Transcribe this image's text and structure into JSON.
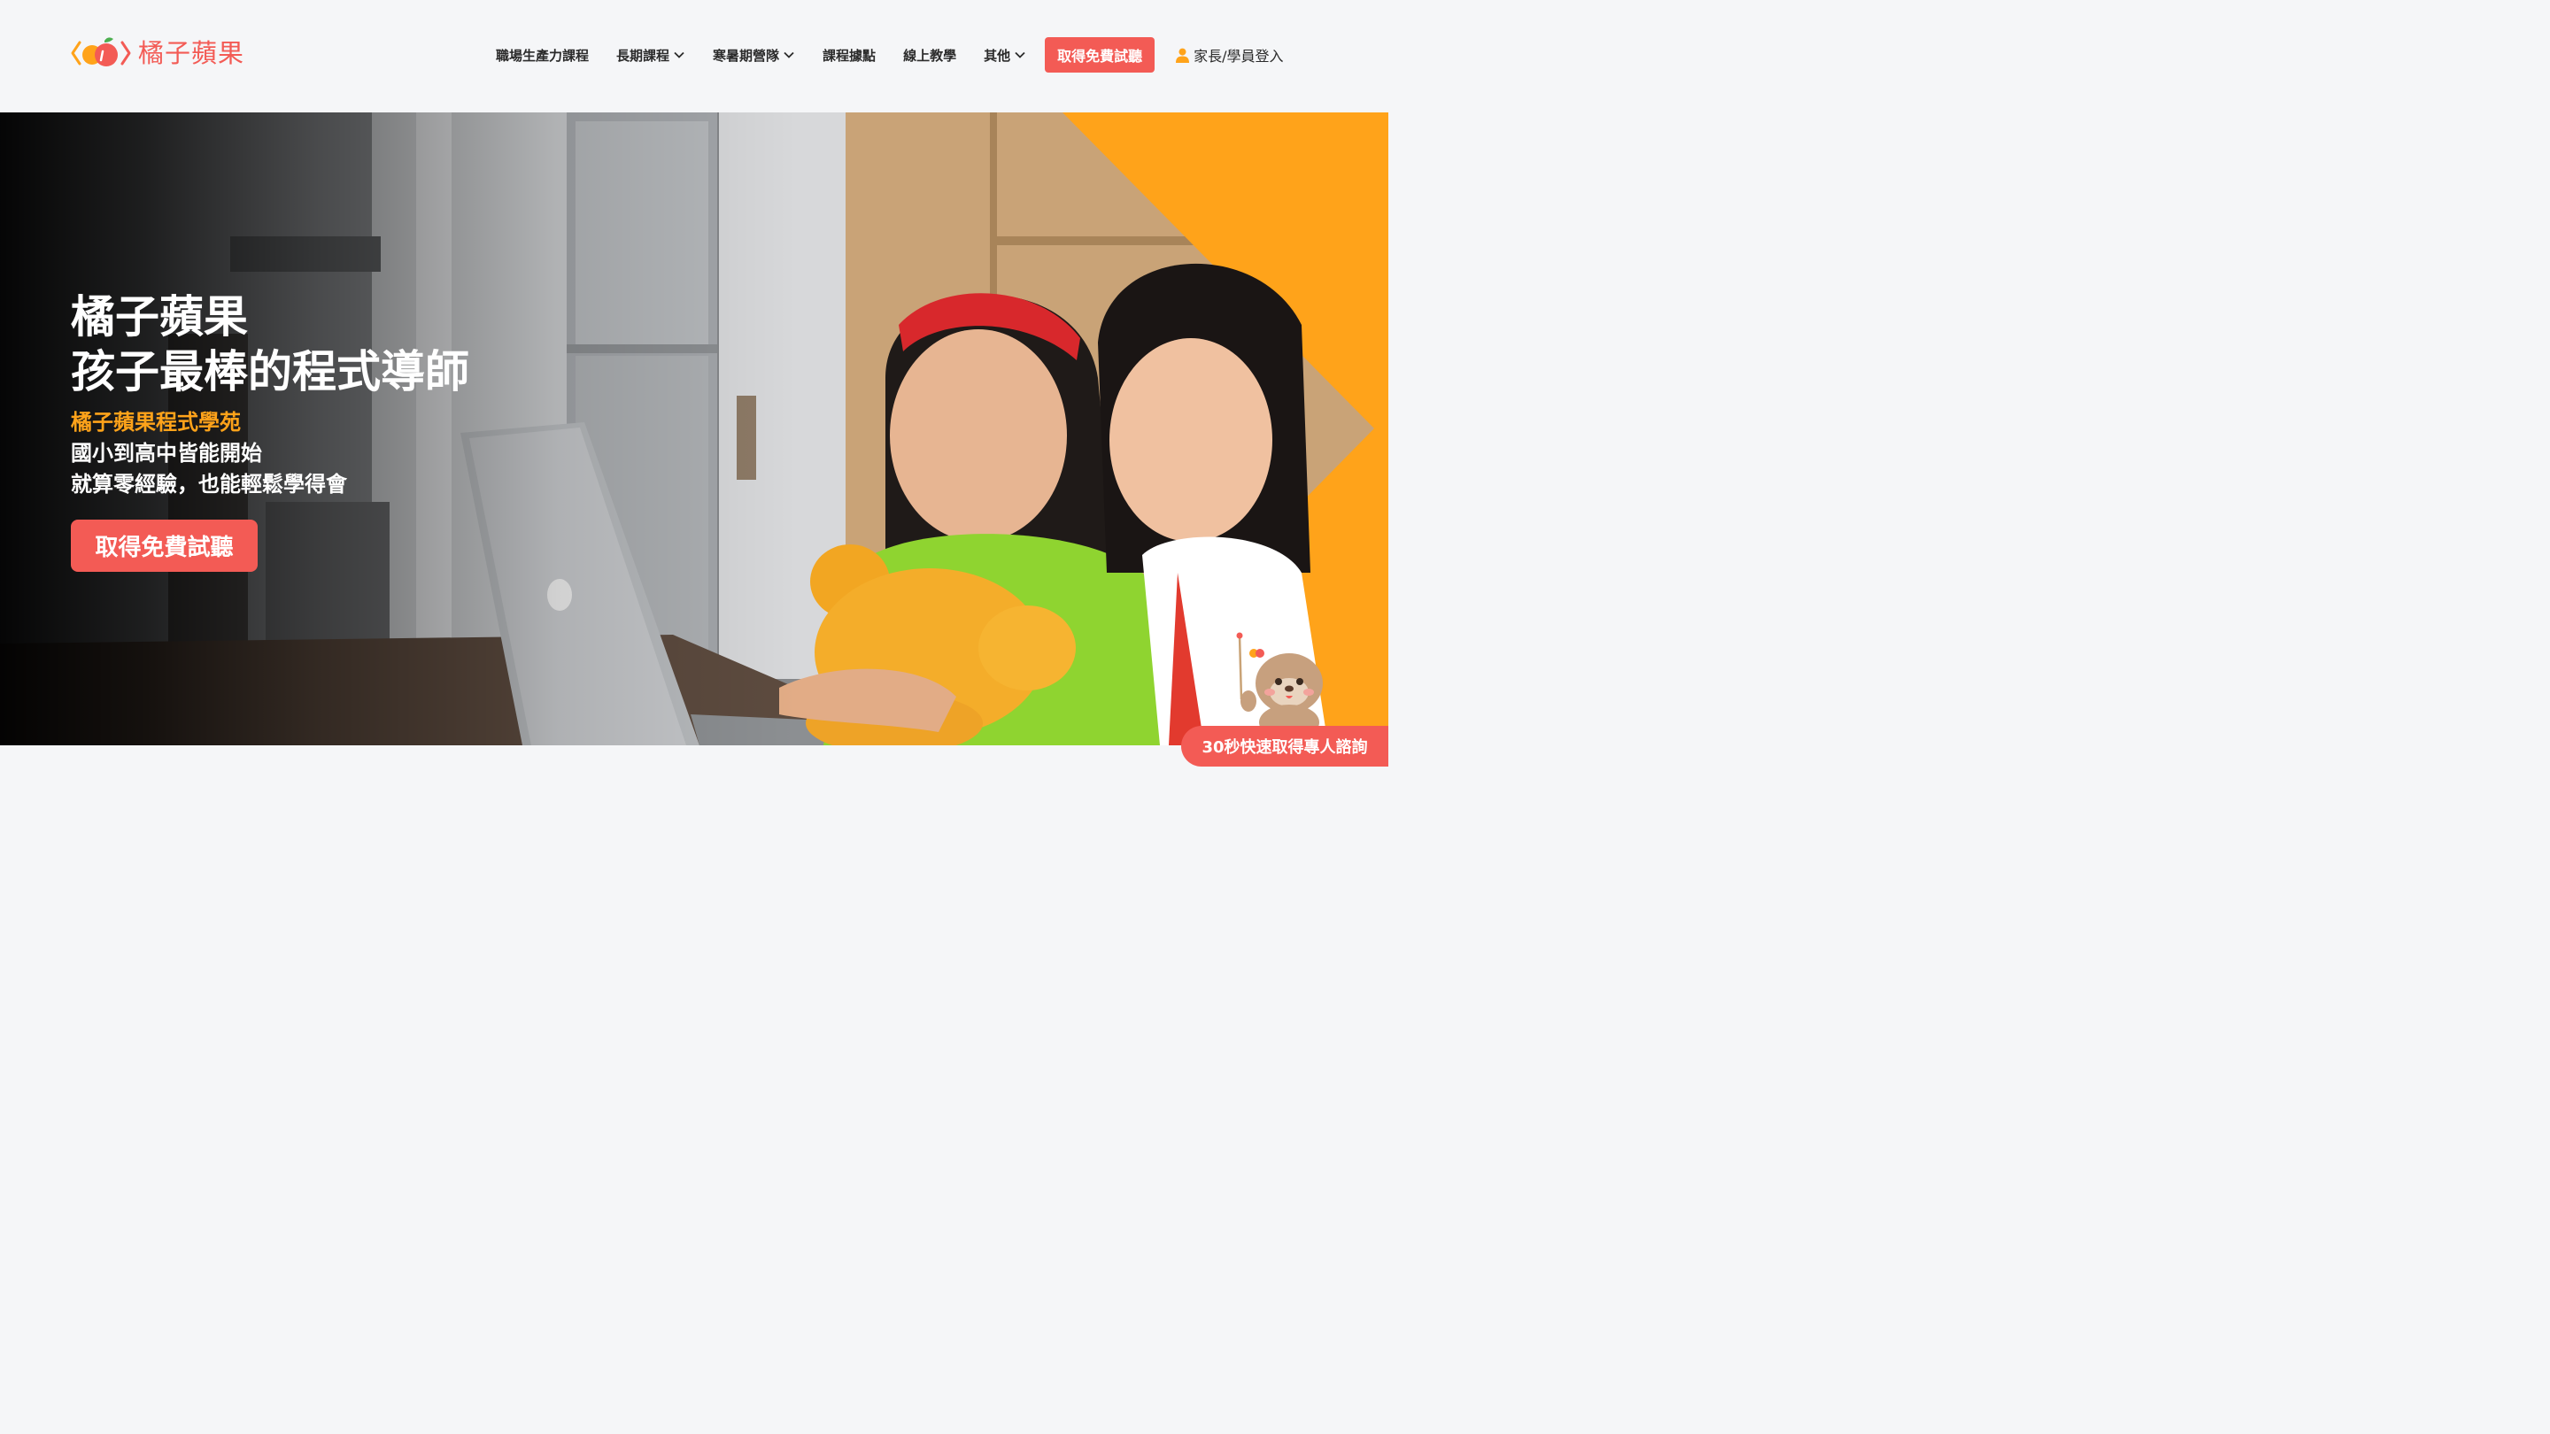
{
  "brand": {
    "name": "橘子蘋果"
  },
  "nav": {
    "items": [
      {
        "label": "職場生產力課程",
        "has_dropdown": false
      },
      {
        "label": "長期課程",
        "has_dropdown": true
      },
      {
        "label": "寒暑期營隊",
        "has_dropdown": true
      },
      {
        "label": "課程據點",
        "has_dropdown": false
      },
      {
        "label": "線上教學",
        "has_dropdown": false
      },
      {
        "label": "其他",
        "has_dropdown": true
      }
    ],
    "cta_label": "取得免費試聽",
    "login_label": "家長/學員登入"
  },
  "hero": {
    "title_line1": "橘子蘋果",
    "title_line2": "孩子最棒的程式導師",
    "subtitle_accent": "橘子蘋果程式學苑",
    "subtitle_line2": "國小到高中皆能開始",
    "subtitle_line3": "就算零經驗，也能輕鬆學得會",
    "cta_label": "取得免費試聽"
  },
  "floating": {
    "consult_label": "30秒快速取得專人諮詢"
  },
  "colors": {
    "brand_red": "#f35b55",
    "brand_orange": "#ffa31a",
    "text_dark": "#2b2b2b",
    "page_bg": "#f5f6f8"
  },
  "icons": {
    "logo": "orange-apple-logo-icon",
    "dropdown": "chevron-down-icon",
    "login": "user-icon"
  }
}
